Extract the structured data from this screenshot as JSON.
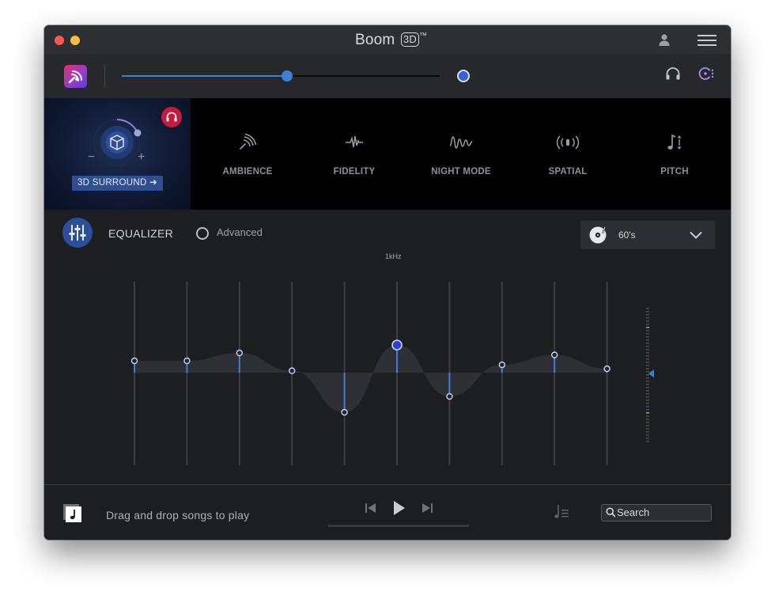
{
  "window": {
    "title": "Boom",
    "title_badge": "3D",
    "title_tm": "™"
  },
  "toolbar": {
    "volume_level": 0.52
  },
  "surround": {
    "button_label": "3D SURROUND ➜"
  },
  "effects": [
    {
      "label": "AMBIENCE",
      "icon": "ambience-icon"
    },
    {
      "label": "FIDELITY",
      "icon": "fidelity-icon"
    },
    {
      "label": "NIGHT MODE",
      "icon": "night-mode-icon"
    },
    {
      "label": "SPATIAL",
      "icon": "spatial-icon"
    },
    {
      "label": "PITCH",
      "icon": "pitch-icon"
    }
  ],
  "equalizer": {
    "title": "EQUALIZER",
    "advanced_label": "Advanced",
    "advanced_checked": false,
    "preset": "60's",
    "freq_label": "1kHz",
    "bands": [
      0.3,
      0.3,
      0.5,
      0.05,
      -1.0,
      0.7,
      -0.6,
      0.2,
      0.45,
      0.1
    ],
    "selected_band": 5,
    "colors": {
      "accent": "#3d7fd6",
      "knob": "#2b3fd0"
    }
  },
  "player": {
    "drop_text": "Drag and drop songs to play",
    "search_placeholder": "Search"
  }
}
